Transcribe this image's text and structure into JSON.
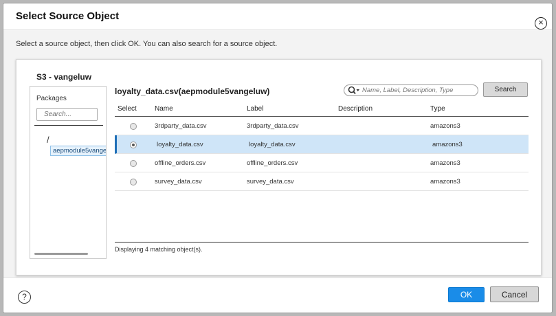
{
  "dialog": {
    "title": "Select Source Object",
    "close_icon": "close-icon",
    "close_glyph": "×",
    "instructions": "Select a source object, then click OK. You can also search for a source object."
  },
  "connection": {
    "name": "S3 - vangeluw"
  },
  "tree": {
    "heading": "Packages",
    "search_placeholder": "Search...",
    "root": "/",
    "selected_node": "aepmodule5vangeluw"
  },
  "objects": {
    "title": "loyalty_data.csv(aepmodule5vangeluw)",
    "search_placeholder": "Name, Label, Description, Type",
    "search_button": "Search",
    "search_icon": "search-icon",
    "columns": {
      "select": "Select",
      "name": "Name",
      "label": "Label",
      "description": "Description",
      "type": "Type"
    },
    "rows": [
      {
        "name": "3rdparty_data.csv",
        "label": "3rdparty_data.csv",
        "description": "",
        "type": "amazons3",
        "selected": false
      },
      {
        "name": "loyalty_data.csv",
        "label": "loyalty_data.csv",
        "description": "",
        "type": "amazons3",
        "selected": true
      },
      {
        "name": "offline_orders.csv",
        "label": "offline_orders.csv",
        "description": "",
        "type": "amazons3",
        "selected": false
      },
      {
        "name": "survey_data.csv",
        "label": "survey_data.csv",
        "description": "",
        "type": "amazons3",
        "selected": false
      }
    ],
    "footer": "Displaying 4 matching object(s)."
  },
  "footer": {
    "help_glyph": "?",
    "help_icon": "help-icon",
    "ok_button": "OK",
    "cancel_button": "Cancel"
  },
  "colors": {
    "accent": "#1a8ce8",
    "selected_row": "#cfe5f8"
  }
}
